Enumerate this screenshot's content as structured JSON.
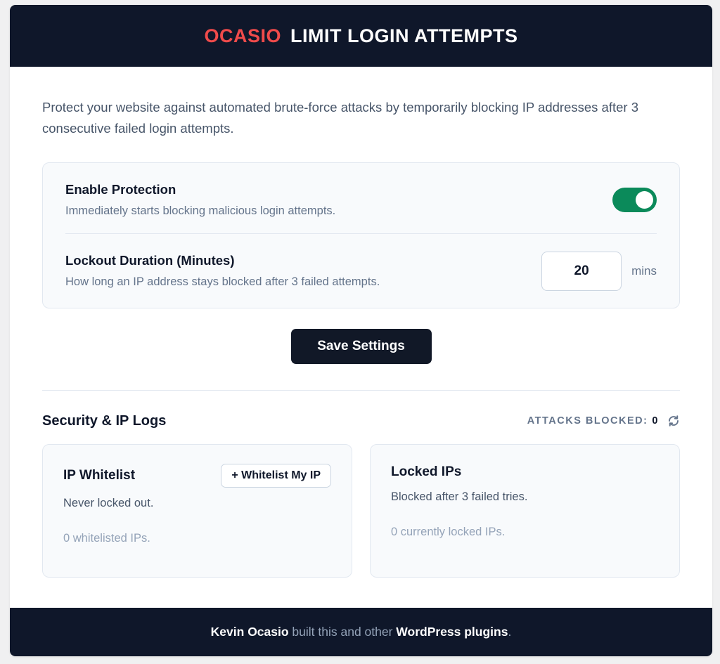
{
  "header": {
    "brand": "OCASIO",
    "title": "LIMIT LOGIN ATTEMPTS"
  },
  "intro": "Protect your website against automated brute-force attacks by temporarily blocking IP addresses after 3 consecutive failed login attempts.",
  "settings": {
    "protection": {
      "label": "Enable Protection",
      "description": "Immediately starts blocking malicious login attempts.",
      "enabled": true
    },
    "lockout": {
      "label": "Lockout Duration (Minutes)",
      "description": "How long an IP address stays blocked after 3 failed attempts.",
      "value": "20",
      "unit": "mins"
    },
    "save_label": "Save Settings"
  },
  "logs": {
    "title": "Security & IP Logs",
    "attacks_label": "ATTACKS BLOCKED:",
    "attacks_count": "0",
    "whitelist": {
      "title": "IP Whitelist",
      "button_label": "+ Whitelist My IP",
      "description": "Never locked out.",
      "empty_text": "0 whitelisted IPs."
    },
    "locked": {
      "title": "Locked IPs",
      "description": "Blocked after 3 failed tries.",
      "empty_text": "0 currently locked IPs."
    }
  },
  "footer": {
    "author": "Kevin Ocasio",
    "middle": " built this and other ",
    "link": "WordPress plugins",
    "end": "."
  },
  "colors": {
    "header_bg": "#0f172a",
    "brand": "#f04b4b",
    "toggle_on": "#0b8a5a",
    "button_bg": "#111827"
  },
  "icons": {
    "refresh": "refresh-icon"
  }
}
